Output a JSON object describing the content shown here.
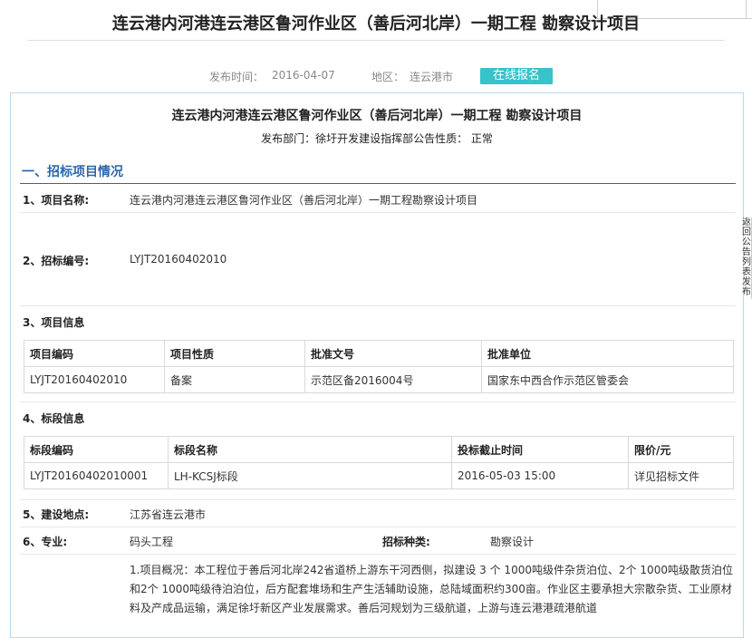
{
  "page": {
    "title": "连云港内河港连云港区鲁河作业区（善后河北岸）一期工程 勘察设计项目",
    "publish_time_label": "发布时间：",
    "publish_time": "2016-04-07",
    "region_label": "地区：",
    "region": "连云港市",
    "register_button": "在线报名"
  },
  "notice": {
    "title": "连云港内河港连云港区鲁河作业区（善后河北岸）一期工程  勘察设计项目",
    "dept_line": "发布部门：徐圩开发建设指挥部公告性质：  正常"
  },
  "section1": {
    "heading": "一、招标项目情况",
    "project_name_label": "1、项目名称:",
    "project_name": "连云港内河港连云港区鲁河作业区（善后河北岸）一期工程勘察设计项目",
    "bid_no_label": "2、招标编号:",
    "bid_no": "LYJT20160402010",
    "project_info_label": "3、项目信息",
    "project_table": {
      "headers": [
        "项目编码",
        "项目性质",
        "批准文号",
        "批准单位"
      ],
      "rows": [
        [
          "LYJT20160402010",
          "备案",
          "示范区备2016004号",
          "国家东中西合作示范区管委会"
        ]
      ]
    },
    "section_info_label": "4、标段信息",
    "section_table": {
      "headers": [
        "标段编码",
        "标段名称",
        "投标截止时间",
        "限价/元"
      ],
      "rows": [
        [
          "LYJT20160402010001",
          "LH-KCSJ标段",
          "2016-05-03 15:00",
          "详见招标文件"
        ]
      ]
    },
    "location_label": "5、建设地点:",
    "location": "江苏省连云港市",
    "specialty_label": "6、专业:",
    "specialty": "码头工程",
    "bid_type_label": "招标种类:",
    "bid_type": "勘察设计",
    "description": "1.项目概况：本工程位于善后河北岸242省道桥上游东干河西侧，拟建设 3 个 1000吨级件杂货泊位、2个 1000吨级散货泊位和2个 1000吨级待泊泊位，后方配套堆场和生产生活辅助设施，总陆域面积约300亩。作业区主要承担大宗散杂货、工业原材料及产成品运输，满足徐圩新区产业发展需求。善后河规划为三级航道，上游与连云港港疏港航道"
  },
  "side_nav": {
    "text": "返回公告列表发布"
  }
}
